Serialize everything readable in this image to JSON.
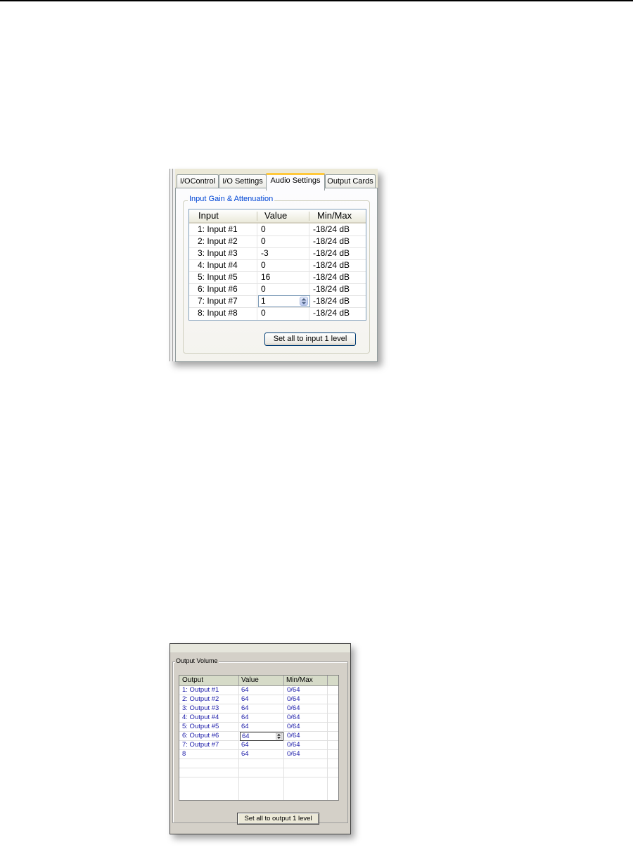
{
  "audio_panel": {
    "tabs": [
      {
        "label": "I/OControl",
        "active": false
      },
      {
        "label": "I/O Settings",
        "active": false
      },
      {
        "label": "Audio Settings",
        "active": true
      },
      {
        "label": "Output Cards",
        "active": false
      }
    ],
    "group_title": "Input Gain & Attenuation",
    "columns": [
      "Input",
      "Value",
      "Min/Max"
    ],
    "rows": [
      {
        "input": "1: Input #1",
        "value": "0",
        "minmax": "-18/24 dB"
      },
      {
        "input": "2: Input #2",
        "value": "0",
        "minmax": "-18/24 dB"
      },
      {
        "input": "3: Input #3",
        "value": "-3",
        "minmax": "-18/24 dB"
      },
      {
        "input": "4: Input #4",
        "value": "0",
        "minmax": "-18/24 dB"
      },
      {
        "input": "5: Input #5",
        "value": "16",
        "minmax": "-18/24 dB"
      },
      {
        "input": "6: Input #6",
        "value": "0",
        "minmax": "-18/24 dB"
      },
      {
        "input": "7: Input #7",
        "value": "1",
        "minmax": "-18/24 dB",
        "editing": true
      },
      {
        "input": "8: Input #8",
        "value": "0",
        "minmax": "-18/24 dB"
      }
    ],
    "button_label": "Set all to input 1 level"
  },
  "output_panel": {
    "group_title": "Output Volume",
    "columns": [
      "Output",
      "Value",
      "Min/Max"
    ],
    "rows": [
      {
        "output": "1: Output #1",
        "value": "64",
        "minmax": "0/64"
      },
      {
        "output": "2: Output #2",
        "value": "64",
        "minmax": "0/64"
      },
      {
        "output": "3: Output #3",
        "value": "64",
        "minmax": "0/64"
      },
      {
        "output": "4: Output #4",
        "value": "64",
        "minmax": "0/64"
      },
      {
        "output": "5: Output #5",
        "value": "64",
        "minmax": "0/64"
      },
      {
        "output": "6: Output #6",
        "value": "64",
        "minmax": "0/64",
        "editing": true
      },
      {
        "output": "7: Output #7",
        "value": "64",
        "minmax": "0/64"
      },
      {
        "output": "8",
        "value": "64",
        "minmax": "0/64"
      }
    ],
    "button_label": "Set all to output 1 level"
  },
  "colors": {
    "tab_accent": "#ffc83c",
    "group_title_blue": "#0046d5",
    "grid_text_blue": "#1a1aa8"
  }
}
